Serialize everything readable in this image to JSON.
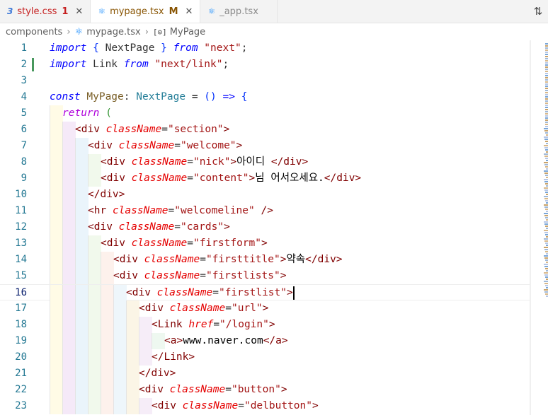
{
  "tabs": [
    {
      "name": "style.css",
      "icon": "css-icon",
      "badge": "1",
      "status": "error",
      "active": false,
      "close": "✕"
    },
    {
      "name": "mypage.tsx",
      "icon": "react-icon",
      "badge": "M",
      "status": "modified",
      "active": true,
      "close": "✕"
    },
    {
      "name": "_app.tsx",
      "icon": "react-icon",
      "badge": "",
      "status": "none",
      "active": false,
      "close": ""
    }
  ],
  "breadcrumb": {
    "folder": "components",
    "file": "mypage.tsx",
    "symbol": "MyPage",
    "sep": "›",
    "symbol_icon": "[⊙]"
  },
  "editor": {
    "current_line": 16,
    "lines": [
      {
        "n": "1",
        "indent": 0,
        "tokens": [
          [
            "k",
            "import"
          ],
          [
            "p",
            " "
          ],
          [
            "br1",
            "{"
          ],
          [
            "p",
            " NextPage "
          ],
          [
            "br1",
            "}"
          ],
          [
            "p",
            " "
          ],
          [
            "k",
            "from"
          ],
          [
            "p",
            " "
          ],
          [
            "st",
            "\"next\""
          ],
          [
            "p",
            ";"
          ]
        ]
      },
      {
        "n": "2",
        "indent": 0,
        "tokens": [
          [
            "k",
            "import"
          ],
          [
            "p",
            " Link "
          ],
          [
            "k",
            "from"
          ],
          [
            "p",
            " "
          ],
          [
            "st",
            "\"next/link\""
          ],
          [
            "p",
            ";"
          ]
        ]
      },
      {
        "n": "3",
        "indent": 0,
        "tokens": []
      },
      {
        "n": "4",
        "indent": 0,
        "tokens": [
          [
            "k",
            "const"
          ],
          [
            "p",
            " "
          ],
          [
            "fn",
            "MyPage"
          ],
          [
            "p",
            ": "
          ],
          [
            "ty",
            "NextPage"
          ],
          [
            "p",
            " "
          ],
          [
            "op",
            "="
          ],
          [
            "p",
            " "
          ],
          [
            "br1",
            "()"
          ],
          [
            "p",
            " "
          ],
          [
            "k",
            "=>"
          ],
          [
            "p",
            " "
          ],
          [
            "br1",
            "{"
          ]
        ]
      },
      {
        "n": "5",
        "indent": 1,
        "tokens": [
          [
            "kw",
            "return"
          ],
          [
            "p",
            " "
          ],
          [
            "br2",
            "("
          ]
        ]
      },
      {
        "n": "6",
        "indent": 2,
        "tokens": [
          [
            "tg",
            "<div"
          ],
          [
            "p",
            " "
          ],
          [
            "at",
            "className"
          ],
          [
            "p",
            "="
          ],
          [
            "st",
            "\"section\""
          ],
          [
            "tg",
            ">"
          ]
        ]
      },
      {
        "n": "7",
        "indent": 3,
        "tokens": [
          [
            "tg",
            "<div"
          ],
          [
            "p",
            " "
          ],
          [
            "at",
            "className"
          ],
          [
            "p",
            "="
          ],
          [
            "st",
            "\"welcome\""
          ],
          [
            "tg",
            ">"
          ]
        ]
      },
      {
        "n": "8",
        "indent": 4,
        "tokens": [
          [
            "tg",
            "<div"
          ],
          [
            "p",
            " "
          ],
          [
            "at",
            "className"
          ],
          [
            "p",
            "="
          ],
          [
            "st",
            "\"nick\""
          ],
          [
            "tg",
            ">"
          ],
          [
            "tx",
            "아이디 "
          ],
          [
            "tg",
            "</div>"
          ]
        ]
      },
      {
        "n": "9",
        "indent": 4,
        "tokens": [
          [
            "tg",
            "<div"
          ],
          [
            "p",
            " "
          ],
          [
            "at",
            "className"
          ],
          [
            "p",
            "="
          ],
          [
            "st",
            "\"content\""
          ],
          [
            "tg",
            ">"
          ],
          [
            "tx",
            "님 어서오세요."
          ],
          [
            "tg",
            "</div>"
          ]
        ]
      },
      {
        "n": "10",
        "indent": 3,
        "tokens": [
          [
            "tg",
            "</div>"
          ]
        ]
      },
      {
        "n": "11",
        "indent": 3,
        "tokens": [
          [
            "tg",
            "<hr"
          ],
          [
            "p",
            " "
          ],
          [
            "at",
            "className"
          ],
          [
            "p",
            "="
          ],
          [
            "st",
            "\"welcomeline\""
          ],
          [
            "p",
            " "
          ],
          [
            "tg",
            "/>"
          ]
        ]
      },
      {
        "n": "12",
        "indent": 3,
        "tokens": [
          [
            "tg",
            "<div"
          ],
          [
            "p",
            " "
          ],
          [
            "at",
            "className"
          ],
          [
            "p",
            "="
          ],
          [
            "st",
            "\"cards\""
          ],
          [
            "tg",
            ">"
          ]
        ]
      },
      {
        "n": "13",
        "indent": 4,
        "tokens": [
          [
            "tg",
            "<div"
          ],
          [
            "p",
            " "
          ],
          [
            "at",
            "className"
          ],
          [
            "p",
            "="
          ],
          [
            "st",
            "\"firstform\""
          ],
          [
            "tg",
            ">"
          ]
        ]
      },
      {
        "n": "14",
        "indent": 5,
        "tokens": [
          [
            "tg",
            "<div"
          ],
          [
            "p",
            " "
          ],
          [
            "at",
            "className"
          ],
          [
            "p",
            "="
          ],
          [
            "st",
            "\"firsttitle\""
          ],
          [
            "tg",
            ">"
          ],
          [
            "tx",
            "약속"
          ],
          [
            "tg",
            "</div>"
          ]
        ]
      },
      {
        "n": "15",
        "indent": 5,
        "tokens": [
          [
            "tg",
            "<div"
          ],
          [
            "p",
            " "
          ],
          [
            "at",
            "className"
          ],
          [
            "p",
            "="
          ],
          [
            "st",
            "\"firstlists\""
          ],
          [
            "tg",
            ">"
          ]
        ]
      },
      {
        "n": "16",
        "indent": 6,
        "tokens": [
          [
            "tg",
            "<div"
          ],
          [
            "p",
            " "
          ],
          [
            "at",
            "className"
          ],
          [
            "p",
            "="
          ],
          [
            "st",
            "\"firstlist\""
          ],
          [
            "tg",
            ">"
          ]
        ]
      },
      {
        "n": "17",
        "indent": 7,
        "tokens": [
          [
            "tg",
            "<div"
          ],
          [
            "p",
            " "
          ],
          [
            "at",
            "className"
          ],
          [
            "p",
            "="
          ],
          [
            "st",
            "\"url\""
          ],
          [
            "tg",
            ">"
          ]
        ]
      },
      {
        "n": "18",
        "indent": 8,
        "tokens": [
          [
            "tg",
            "<Link"
          ],
          [
            "p",
            " "
          ],
          [
            "at",
            "href"
          ],
          [
            "p",
            "="
          ],
          [
            "st",
            "\"/login\""
          ],
          [
            "tg",
            ">"
          ]
        ]
      },
      {
        "n": "19",
        "indent": 9,
        "tokens": [
          [
            "tg",
            "<a>"
          ],
          [
            "tx",
            "www.naver.com"
          ],
          [
            "tg",
            "</a>"
          ]
        ]
      },
      {
        "n": "20",
        "indent": 8,
        "tokens": [
          [
            "tg",
            "</Link>"
          ]
        ]
      },
      {
        "n": "21",
        "indent": 7,
        "tokens": [
          [
            "tg",
            "</div>"
          ]
        ]
      },
      {
        "n": "22",
        "indent": 7,
        "tokens": [
          [
            "tg",
            "<div"
          ],
          [
            "p",
            " "
          ],
          [
            "at",
            "className"
          ],
          [
            "p",
            "="
          ],
          [
            "st",
            "\"button\""
          ],
          [
            "tg",
            ">"
          ]
        ]
      },
      {
        "n": "23",
        "indent": 8,
        "tokens": [
          [
            "tg",
            "<div"
          ],
          [
            "p",
            " "
          ],
          [
            "at",
            "className"
          ],
          [
            "p",
            "="
          ],
          [
            "st",
            "\"delbutton\""
          ],
          [
            "tg",
            ">"
          ]
        ]
      }
    ]
  },
  "colors": {
    "indent_guides": [
      "#fffbe6",
      "#f5e9f8",
      "#eaf4fb",
      "#f1f9ec",
      "#fdf1ec",
      "#eef6fb",
      "#fbf5e6",
      "#f6edf8",
      "#eef8f0"
    ],
    "modified_gutter": "#48985d"
  }
}
